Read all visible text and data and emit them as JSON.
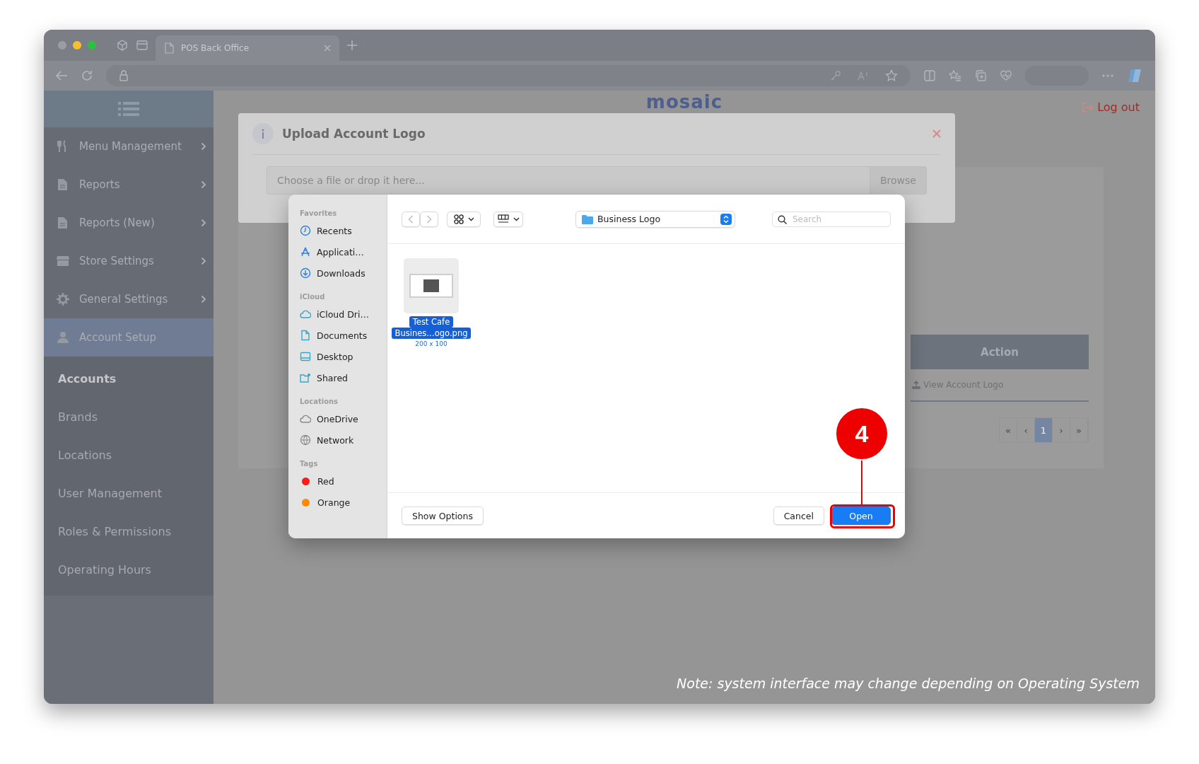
{
  "browser": {
    "tabs": [
      {
        "title": "POS Back Office",
        "selected": true
      }
    ]
  },
  "header": {
    "logo": "mosaic",
    "logout": "Log out"
  },
  "sidebar": {
    "items": [
      {
        "label": "Menu Management",
        "has_children": true,
        "selected": false
      },
      {
        "label": "Reports",
        "has_children": true,
        "selected": false
      },
      {
        "label": "Reports (New)",
        "has_children": true,
        "selected": false
      },
      {
        "label": "Store Settings",
        "has_children": true,
        "selected": false
      },
      {
        "label": "General Settings",
        "has_children": true,
        "selected": false
      },
      {
        "label": "Account Setup",
        "has_children": false,
        "selected": true
      }
    ],
    "sub_items": [
      {
        "label": "Accounts",
        "selected": true
      },
      {
        "label": "Brands",
        "selected": false
      },
      {
        "label": "Locations",
        "selected": false
      },
      {
        "label": "User Management",
        "selected": false
      },
      {
        "label": "Roles & Permissions",
        "selected": false
      },
      {
        "label": "Operating Hours",
        "selected": false
      }
    ]
  },
  "table": {
    "columns": [
      "Action"
    ],
    "rows": [
      [
        "View Account Logo"
      ]
    ]
  },
  "pagination": [
    {
      "label": "«",
      "selected": false
    },
    {
      "label": "‹",
      "selected": false
    },
    {
      "label": "1",
      "selected": true
    },
    {
      "label": "›",
      "selected": false
    },
    {
      "label": "»",
      "selected": false
    }
  ],
  "upload_modal": {
    "title": "Upload Account Logo",
    "placeholder": "Choose a file or drop it here...",
    "browse": "Browse"
  },
  "file_dialog": {
    "sidebar": [
      {
        "heading": "Favorites",
        "items": [
          {
            "label": "Recents"
          },
          {
            "label": "Applicati…"
          },
          {
            "label": "Downloads"
          }
        ]
      },
      {
        "heading": "iCloud",
        "items": [
          {
            "label": "iCloud Dri…"
          },
          {
            "label": "Documents"
          },
          {
            "label": "Desktop"
          },
          {
            "label": "Shared"
          }
        ]
      },
      {
        "heading": "Locations",
        "items": [
          {
            "label": "OneDrive"
          },
          {
            "label": "Network"
          }
        ]
      },
      {
        "heading": "Tags",
        "items": [
          {
            "label": "Red",
            "color": "#ff1a1a"
          },
          {
            "label": "Orange",
            "color": "#ff8a00"
          }
        ]
      }
    ],
    "location": "Business Logo",
    "search_placeholder": "Search",
    "files": [
      {
        "name_lines": [
          "Test Cafe",
          "Busines…ogo.png"
        ],
        "dimensions": "200 x 100",
        "selected": true
      }
    ],
    "buttons": [
      {
        "label": "Show Options",
        "kind": "secondary"
      },
      {
        "label": "Cancel",
        "kind": "secondary"
      },
      {
        "label": "Open",
        "kind": "primary"
      }
    ]
  },
  "step_marker": {
    "label": "4"
  },
  "note": "Note: system interface may change depending on Operating System"
}
